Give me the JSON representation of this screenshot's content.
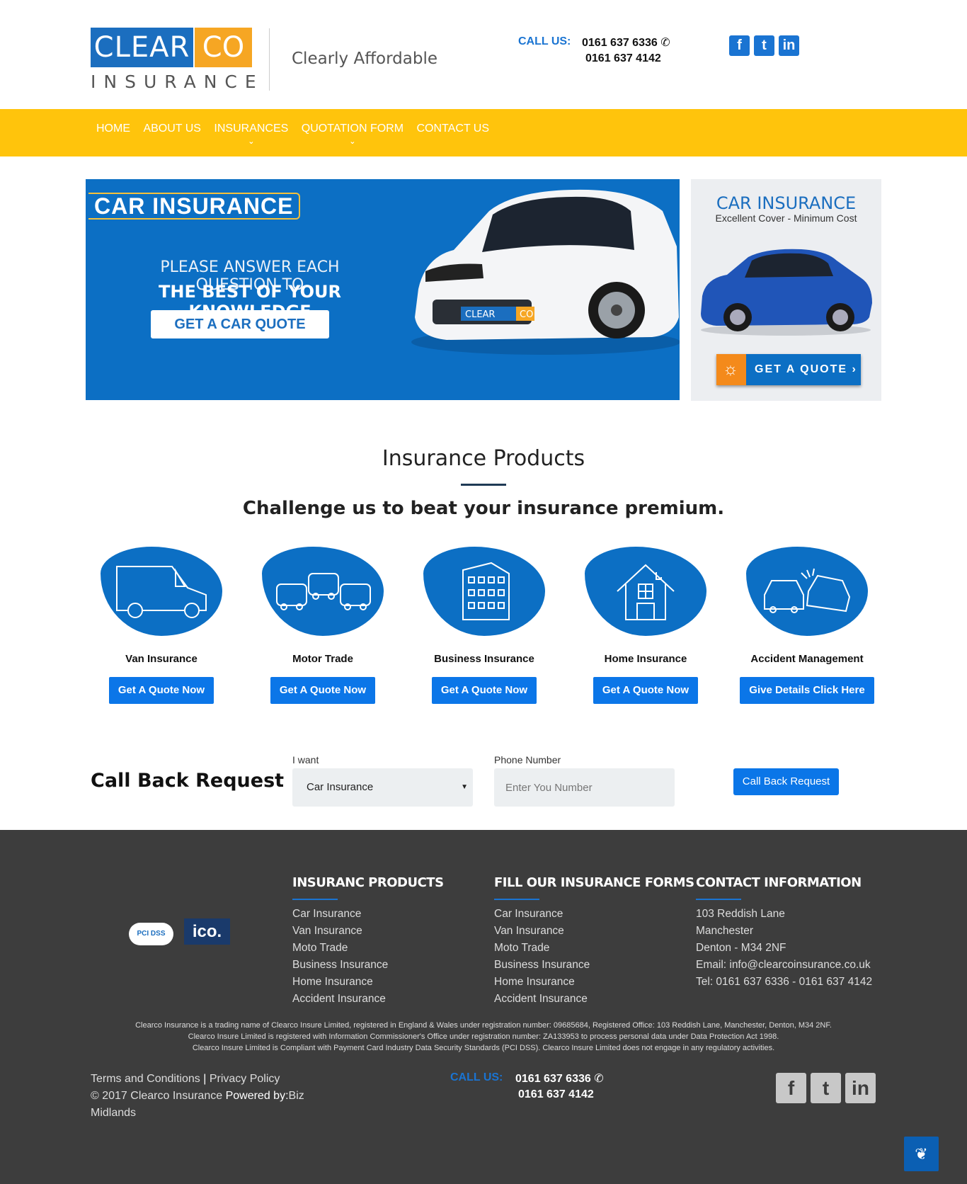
{
  "header": {
    "logo_clear": "CLEAR",
    "logo_co": "CO",
    "logo_insurance": "INSURANCE",
    "tagline": "Clearly Affordable",
    "call_label": "CALL US:",
    "phone_1": "0161 637 6336",
    "phone_2": "0161 637 4142",
    "social": [
      "f",
      "t",
      "in"
    ]
  },
  "nav": {
    "items": [
      {
        "label": "HOME"
      },
      {
        "label": "ABOUT US"
      },
      {
        "label": "INSURANCES"
      },
      {
        "label": "QUOTATION FORM"
      },
      {
        "label": "CONTACT US"
      }
    ]
  },
  "hero": {
    "tag": "CAR INSURANCE",
    "line1": "PLEASE ANSWER EACH QUESTION TO",
    "line2": "THE BEST OF YOUR KNOWLEDGE",
    "button": "GET A CAR QUOTE",
    "plate_clear": "CLEAR",
    "plate_co": "CO"
  },
  "side_ad": {
    "title": "CAR INSURANCE",
    "subtitle": "Excellent Cover - Minimum Cost",
    "button": "GET A QUOTE ›"
  },
  "products": {
    "title": "Insurance Products",
    "subtitle": "Challenge us to beat your insurance premium.",
    "items": [
      {
        "name": "Van Insurance",
        "button": "Get A Quote Now",
        "icon": "van-icon"
      },
      {
        "name": "Motor Trade",
        "button": "Get A Quote Now",
        "icon": "cars-icon"
      },
      {
        "name": "Business Insurance",
        "button": "Get A Quote Now",
        "icon": "building-icon"
      },
      {
        "name": "Home Insurance",
        "button": "Get A Quote Now",
        "icon": "house-icon"
      },
      {
        "name": "Accident Management",
        "button": "Give Details Click Here",
        "icon": "car-crash-icon"
      }
    ]
  },
  "callback": {
    "title": "Call Back Request",
    "want_label": "I want",
    "want_value": "Car Insurance",
    "phone_label": "Phone Number",
    "phone_placeholder": "Enter You Number",
    "button": "Call Back Request"
  },
  "footer": {
    "badge_pci": "PCI DSS",
    "badge_ico": "ico.",
    "col1": {
      "title": "INSURANC PRODUCTS",
      "items": [
        "Car Insurance",
        "Van Insurance",
        "Moto Trade",
        "Business Insurance",
        "Home Insurance",
        "Accident Insurance"
      ]
    },
    "col2": {
      "title": "FILL OUR INSURANCE FORMS",
      "items": [
        "Car Insurance",
        "Van Insurance",
        "Moto Trade",
        "Business Insurance",
        "Home Insurance",
        "Accident Insurance"
      ]
    },
    "col3": {
      "title": "CONTACT INFORMATION",
      "items": [
        "103 Reddish Lane",
        "Manchester",
        "Denton - M34 2NF",
        "Email: info@clearcoinsurance.co.uk",
        "Tel: 0161 637 6336 - 0161 637 4142"
      ]
    },
    "legal": [
      "Clearco Insurance is a trading name of Clearco Insure Limited, registered in England & Wales under registration number: 09685684, Registered Office: 103 Reddish Lane, Manchester, Denton, M34 2NF.",
      "Clearco Insure Limited is registered with Information Commissioner's Office under registration number: ZA133953 to process personal data under Data Protection Act 1998.",
      "Clearco Insure Limited is Compliant with Payment Card Industry Data Security Standards (PCI DSS). Clearco Insure Limited does not engage in any regulatory activities."
    ],
    "terms": "Terms and Conditions",
    "separator": "|",
    "privacy": "Privacy Policy",
    "copyright": "© 2017 Clearco Insurance",
    "powered_by": "Powered by:",
    "powered_link": "Biz Midlands",
    "call_label": "CALL US:",
    "phone_1": "0161 637 6336",
    "phone_2": "0161 637 4142",
    "social": [
      "f",
      "t",
      "in"
    ]
  },
  "colors": {
    "brand_blue": "#0c6fc4",
    "button_blue": "#0b76e8",
    "nav_yellow": "#ffc40c",
    "footer_bg": "#3d3d3d",
    "logo_orange": "#f6a623"
  }
}
